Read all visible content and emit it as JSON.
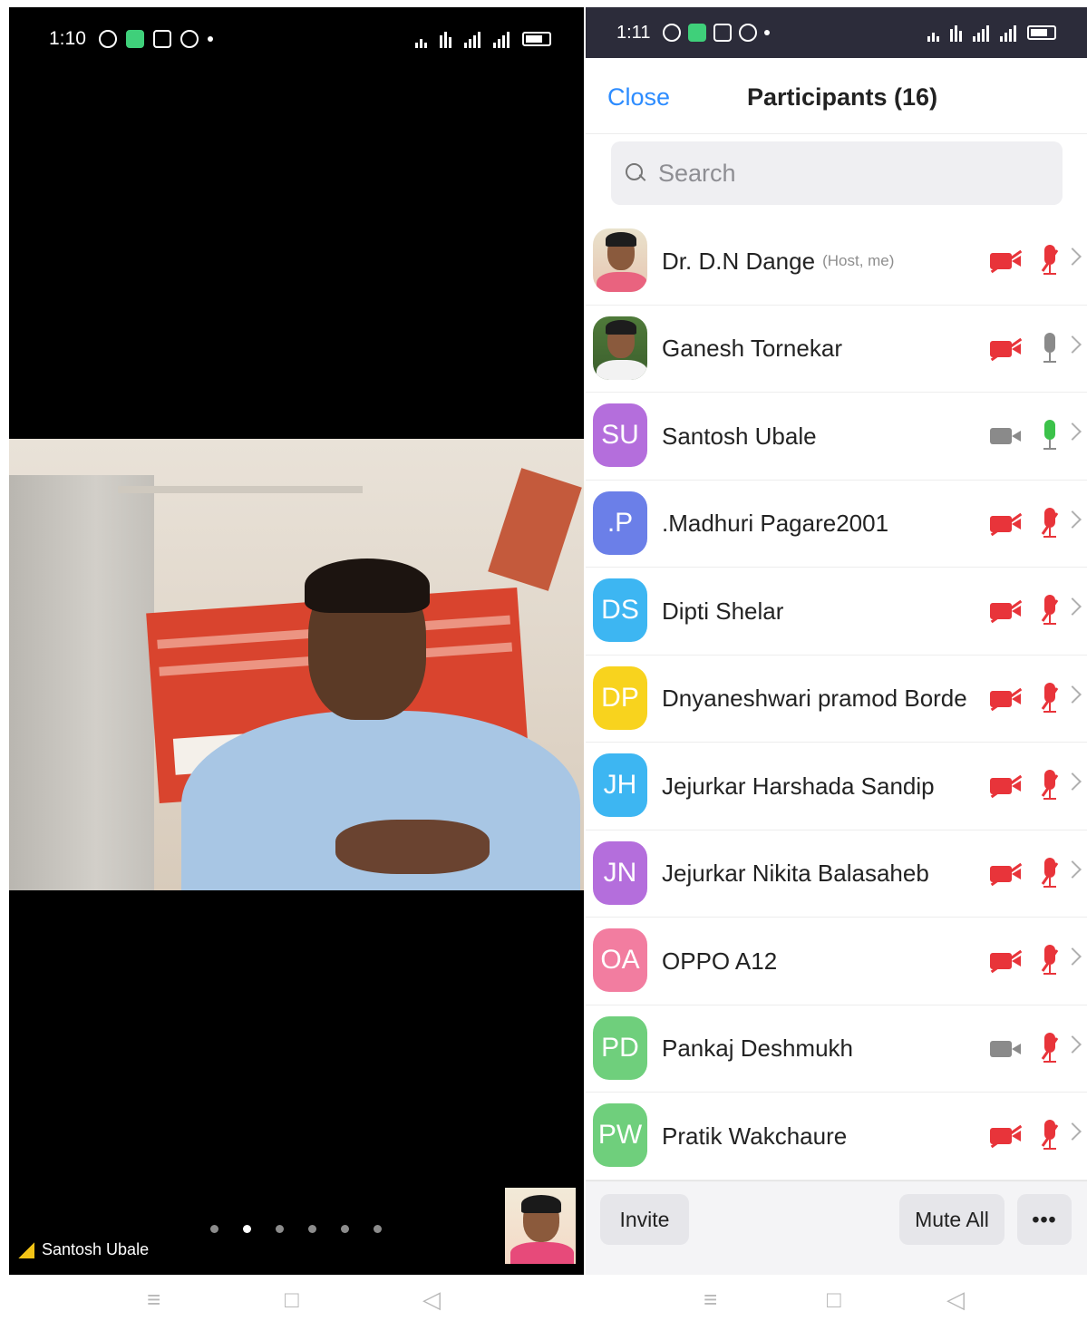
{
  "left": {
    "status": {
      "time": "1:10"
    },
    "speaker_name": "Santosh Ubale",
    "page_dots": {
      "count": 6,
      "active": 2
    }
  },
  "right": {
    "status": {
      "time": "1:11"
    },
    "header": {
      "close_label": "Close",
      "title": "Participants (16)"
    },
    "search": {
      "placeholder": "Search"
    },
    "participants": [
      {
        "initials": "",
        "name": "Dr. D.N Dange",
        "tag": "(Host, me)",
        "avatar_color": "#ffffff",
        "video": "off",
        "audio": "muted"
      },
      {
        "initials": "",
        "name": "Ganesh Tornekar",
        "tag": "",
        "avatar_color": "#ffffff",
        "video": "off",
        "audio": "idle"
      },
      {
        "initials": "SU",
        "name": "Santosh Ubale",
        "tag": "",
        "avatar_color": "#b46edc",
        "video": "on",
        "audio": "talking"
      },
      {
        "initials": ".P",
        "name": ".Madhuri Pagare2001",
        "tag": "",
        "avatar_color": "#6b7fe8",
        "video": "off",
        "audio": "muted"
      },
      {
        "initials": "DS",
        "name": "Dipti Shelar",
        "tag": "",
        "avatar_color": "#3db6f2",
        "video": "off",
        "audio": "muted"
      },
      {
        "initials": "DP",
        "name": "Dnyaneshwari pramod Borde",
        "tag": "",
        "avatar_color": "#f8d31e",
        "video": "off",
        "audio": "muted"
      },
      {
        "initials": "JH",
        "name": "Jejurkar Harshada Sandip",
        "tag": "",
        "avatar_color": "#3db6f2",
        "video": "off",
        "audio": "muted"
      },
      {
        "initials": "JN",
        "name": "Jejurkar Nikita Balasaheb",
        "tag": "",
        "avatar_color": "#b46edc",
        "video": "off",
        "audio": "muted"
      },
      {
        "initials": "OA",
        "name": "OPPO A12",
        "tag": "",
        "avatar_color": "#f27da0",
        "video": "off",
        "audio": "muted"
      },
      {
        "initials": "PD",
        "name": "Pankaj Deshmukh",
        "tag": "",
        "avatar_color": "#6fcf7c",
        "video": "on",
        "audio": "muted"
      },
      {
        "initials": "PW",
        "name": "Pratik Wakchaure",
        "tag": "",
        "avatar_color": "#6fcf7c",
        "video": "off",
        "audio": "muted"
      }
    ],
    "footer": {
      "invite_label": "Invite",
      "mute_all_label": "Mute All",
      "more_label": "•••"
    }
  },
  "nav": {
    "menu_icon": "≡",
    "home_icon": "□",
    "back_icon": "◁"
  },
  "colors": {
    "accent": "#2d8cff",
    "muted_red": "#e8343a",
    "talking_green": "#3cc24a"
  }
}
